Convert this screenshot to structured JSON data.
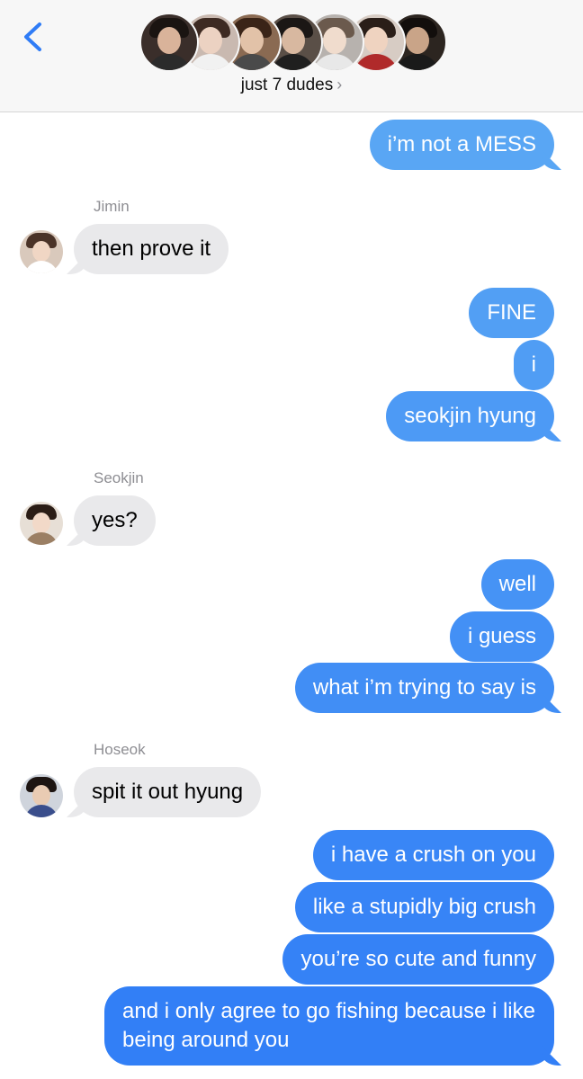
{
  "header": {
    "back_icon": "chevron-left-icon",
    "group_name": "just 7 dudes",
    "title_chevron": "›",
    "accent_color": "#2f7cf6",
    "member_avatars": [
      {
        "icon": "member-avatar",
        "bg": "#3a2e2a",
        "hair": "#1a1411",
        "face": "#d9b39a",
        "body": "#2b2b2b"
      },
      {
        "icon": "member-avatar",
        "bg": "#c9b9b0",
        "hair": "#3d2a22",
        "face": "#ecd2c2",
        "body": "#f1f1f1"
      },
      {
        "icon": "member-avatar",
        "bg": "#8a6a52",
        "hair": "#3a2417",
        "face": "#e2c2a8",
        "body": "#4a4a4a"
      },
      {
        "icon": "member-avatar",
        "bg": "#5a4f47",
        "hair": "#1b1715",
        "face": "#d8b8a0",
        "body": "#1f1f1f"
      },
      {
        "icon": "member-avatar",
        "bg": "#b7b2ae",
        "hair": "#6b5a4d",
        "face": "#f0dccd",
        "body": "#e8e8e8"
      },
      {
        "icon": "member-avatar",
        "bg": "#d7ccc4",
        "hair": "#2a1e18",
        "face": "#efd3c0",
        "body": "#b02a2a"
      },
      {
        "icon": "member-avatar",
        "bg": "#2c2520",
        "hair": "#120e0c",
        "face": "#c9a488",
        "body": "#1a1a1a"
      }
    ]
  },
  "messages": {
    "m1": "i’m not a MESS",
    "s1": "Jimin",
    "m2": "then prove it",
    "m3": "FINE",
    "m4": "i",
    "m5": "seokjin hyung",
    "s2": "Seokjin",
    "m6": "yes?",
    "m7": "well",
    "m8": "i guess",
    "m9": "what i’m trying to say is",
    "s3": "Hoseok",
    "m10": "spit it out hyung",
    "m11": "i have a crush on you",
    "m12": "like a stupidly big crush",
    "m13": "you’re so cute and funny",
    "m14": "and i only agree to go fishing because i like being around you"
  },
  "sender_avatars": {
    "jimin": {
      "icon": "jimin-avatar",
      "bg": "#d9c9bc",
      "hair": "#4a3328",
      "face": "#f0d6c4",
      "body": "#ffffff"
    },
    "seokjin": {
      "icon": "seokjin-avatar",
      "bg": "#e7dfd6",
      "hair": "#2b1d16",
      "face": "#f2d9c8",
      "body": "#9b7f64"
    },
    "hoseok": {
      "icon": "hoseok-avatar",
      "bg": "#cfd4dc",
      "hair": "#1d1512",
      "face": "#e9cbb3",
      "body": "#3a4e8c"
    }
  },
  "colors": {
    "outgoing_top": "#5aa7f4",
    "outgoing_bottom": "#2f7cf6",
    "incoming": "#e9e9eb"
  }
}
